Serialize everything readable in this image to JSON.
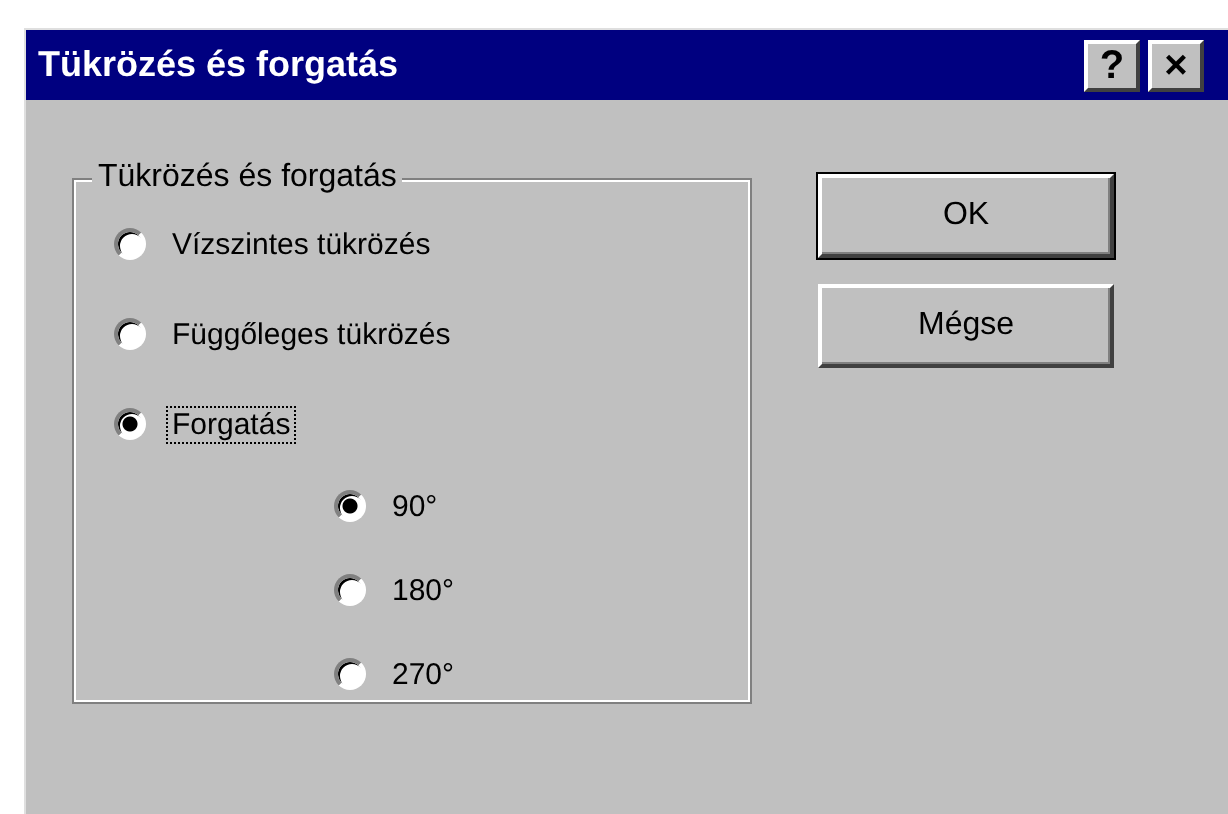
{
  "window": {
    "title": "Tükrözés és forgatás",
    "title_buttons": [
      "?",
      "×"
    ]
  },
  "group": {
    "label": "Tükrözés és forgatás",
    "options": [
      {
        "label": "Vízszintes tükrözés",
        "selected": false,
        "focused": false
      },
      {
        "label": "Függőleges tükrözés",
        "selected": false,
        "focused": false
      },
      {
        "label": "Forgatás",
        "selected": true,
        "focused": true
      }
    ],
    "angles": [
      {
        "label": "90°",
        "selected": true
      },
      {
        "label": "180°",
        "selected": false
      },
      {
        "label": "270°",
        "selected": false
      }
    ]
  },
  "buttons": [
    {
      "label": "OK",
      "default": true
    },
    {
      "label": "Mégse",
      "default": false
    }
  ]
}
